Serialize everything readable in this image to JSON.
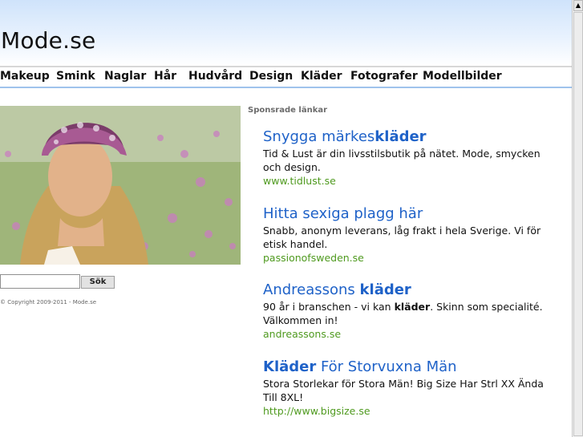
{
  "site": {
    "title": "Mode.se"
  },
  "nav": {
    "items": [
      {
        "label": "Makeup"
      },
      {
        "label": "Smink"
      },
      {
        "label": "Naglar"
      },
      {
        "label": "Hår"
      },
      {
        "label": "Hudvård"
      },
      {
        "label": "Design"
      },
      {
        "label": "Kläder"
      },
      {
        "label": "Fotografer"
      },
      {
        "label": "Modellbilder"
      }
    ]
  },
  "search": {
    "button_label": "Sök",
    "value": ""
  },
  "footer": {
    "copyright": "© Copyright 2009-2011 - Mode.se"
  },
  "ads": {
    "heading": "Sponsrade länkar",
    "items": [
      {
        "title_pre": "Snygga märkes",
        "title_bold": "kläder",
        "title_post": "",
        "text_pre": "Tid & Lust är din livsstilsbutik på nätet. Mode, smycken och design.",
        "text_bold": "",
        "text_post": "",
        "url": "www.tidlust.se"
      },
      {
        "title_pre": "Hitta sexiga plagg här",
        "title_bold": "",
        "title_post": "",
        "text_pre": "Snabb, anonym leverans, låg frakt i hela Sverige. Vi för etisk handel.",
        "text_bold": "",
        "text_post": "",
        "url": "passionofsweden.se"
      },
      {
        "title_pre": "Andreassons ",
        "title_bold": "kläder",
        "title_post": "",
        "text_pre": "90 år i branschen - vi kan ",
        "text_bold": "kläder",
        "text_post": ". Skinn som specialité. Välkommen in!",
        "url": "andreassons.se"
      },
      {
        "title_pre": "",
        "title_bold": "Kläder",
        "title_post": " För Storvuxna Män",
        "text_pre": "Stora Storlekar för Stora Män! Big Size Har Strl XX Ända Till 8XL!",
        "text_bold": "",
        "text_post": "",
        "url": "http://www.bigsize.se"
      }
    ]
  },
  "colors": {
    "link_title": "#1f62c8",
    "link_url": "#4f9a1f",
    "nav_underline": "#9fc3ec"
  }
}
